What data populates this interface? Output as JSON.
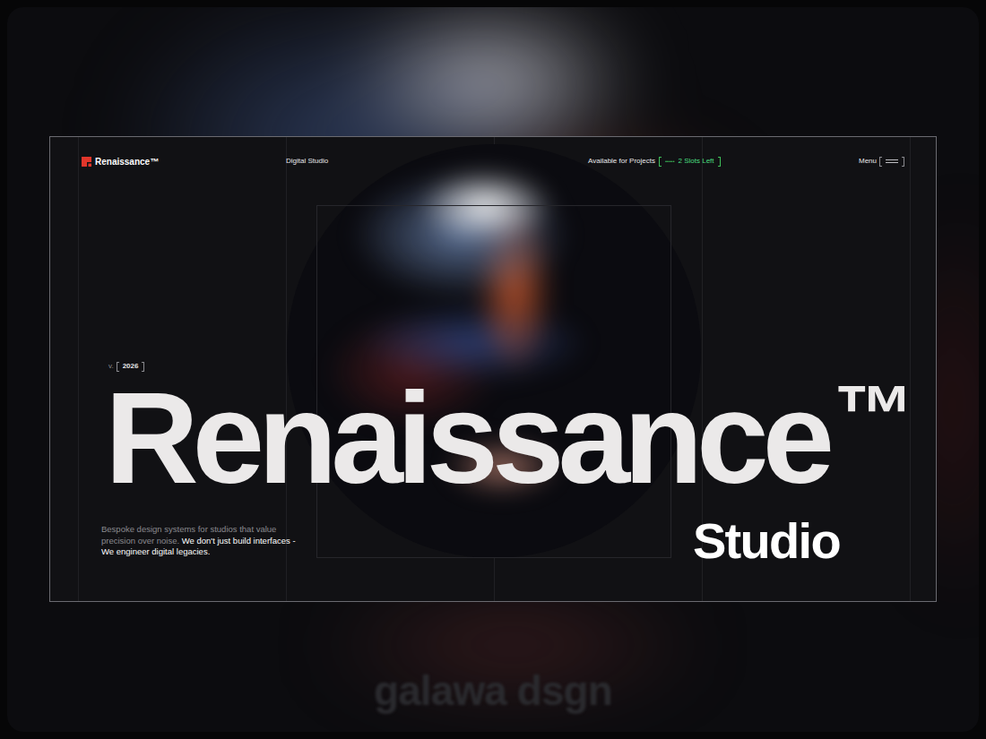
{
  "nav": {
    "brand": "Renaissance™",
    "tagline": "Digital Studio",
    "availability": "Available for Projects",
    "slots_badge": {
      "dots": "•••••",
      "label": "2 Slots Left"
    },
    "menu": "Menu"
  },
  "hero": {
    "version_prefix": "v.",
    "version": "2026",
    "title": "Renaissance",
    "title_mark": "™",
    "subtitle": "Studio",
    "description": [
      {
        "text": "Bespoke design systems for studios that value precision over noise.",
        "highlighted": false
      },
      {
        "text": "We don't just build interfaces - We engineer digital legacies.",
        "highlighted": true
      }
    ]
  },
  "watermark": "galawa dsgn"
}
